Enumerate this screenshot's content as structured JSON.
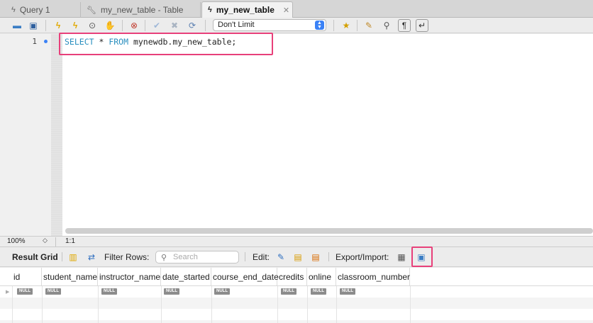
{
  "tabs": [
    {
      "icon": "lightning-icon",
      "label": "Query 1",
      "active": false
    },
    {
      "icon": "wrench-icon",
      "label": "my_new_table - Table",
      "active": false
    },
    {
      "icon": "lightning-icon",
      "label": "my_new_table",
      "active": true
    }
  ],
  "tab_close": "✕",
  "toolbar": {
    "limit_value": "Don't Limit",
    "icons": [
      "open-folder-icon",
      "save-icon",
      "execute-icon",
      "execute-current-icon",
      "explain-icon",
      "stop-icon",
      "toggle-error-icon",
      "commit-icon",
      "rollback-icon",
      "autocommit-icon",
      "bookmark-icon",
      "beautify-icon",
      "find-icon",
      "invisibles-icon",
      "wrap-icon"
    ]
  },
  "editor": {
    "line_number": "1",
    "code": {
      "kw1": "SELECT",
      "star": " * ",
      "kw2": "FROM",
      "rest": " mynewdb.my_new_table;"
    }
  },
  "status": {
    "zoom": "100%",
    "cursor": "1:1"
  },
  "result_toolbar": {
    "result_grid": "Result Grid",
    "filter_rows": "Filter Rows:",
    "search_placeholder": "Search",
    "edit": "Edit:",
    "export_import": "Export/Import:"
  },
  "grid": {
    "columns": [
      "id",
      "student_name",
      "instructor_name",
      "date_started",
      "course_end_date",
      "credits",
      "online",
      "classroom_number"
    ],
    "null_label": "NULL"
  },
  "colors": {
    "highlight": "#e8407a",
    "keyword": "#2a8fbf"
  }
}
